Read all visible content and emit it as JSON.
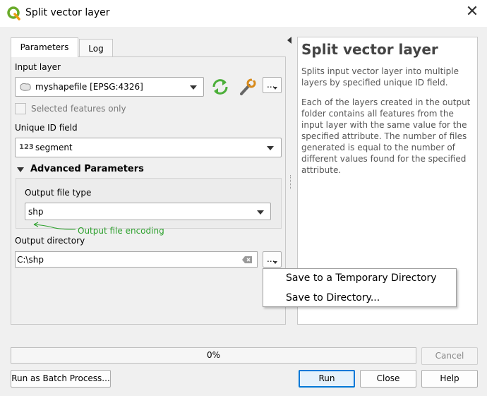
{
  "window": {
    "title": "Split vector layer",
    "close_symbol": "✕"
  },
  "tabs": [
    {
      "label": "Parameters"
    },
    {
      "label": "Log"
    }
  ],
  "params": {
    "input_layer_label": "Input layer",
    "input_layer_value": "myshapefile [EPSG:4326]",
    "selected_only_label": "Selected features only",
    "unique_id_label": "Unique ID field",
    "unique_id_type": "123",
    "unique_id_value": "segment",
    "advanced_label": "Advanced Parameters",
    "output_file_type_label": "Output file type",
    "output_file_type_value": "shp",
    "annotation": "Output file encoding",
    "output_dir_label": "Output directory",
    "output_dir_value": "C:\\shp",
    "browse_label": "..."
  },
  "menu": {
    "items": [
      "Save to a Temporary Directory",
      "Save to Directory..."
    ]
  },
  "help": {
    "title": "Split vector layer",
    "p1": "Splits input vector layer into multiple layers by specified unique ID field.",
    "p2": "Each of the layers created in the output folder contains all features from the input layer with the same value for the specified attribute. The number of files generated is equal to the number of different values found for the specified attribute."
  },
  "progress": {
    "text": "0%",
    "value": 0
  },
  "buttons": {
    "cancel": "Cancel",
    "batch": "Run as Batch Process...",
    "run": "Run",
    "close": "Close",
    "help": "Help"
  },
  "colors": {
    "annotation": "#2ca02c",
    "accent": "#0078d7",
    "qgis_green": "#6aab2a"
  }
}
